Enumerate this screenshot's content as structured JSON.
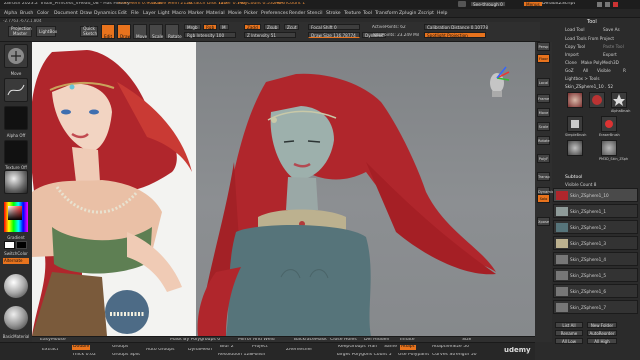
{
  "titlebar": {
    "app": "ZBrush 2023.2",
    "file": "Tribal_Princess_vHead_08 - Has History",
    "free_mem": "Free Mem 0.905GB",
    "active_mem": "Active Mem 2120",
    "scratch_disk": "Scratch Disk 125",
    "timer": "Timer 0.192",
    "polycount": "PolyCount 0.532 KP",
    "meshcount": "MeshCount 1",
    "see_through_label": "See-through 0",
    "menus_label": "Menus",
    "default_zscript": "DefaultZScript"
  },
  "menubar": {
    "items": [
      "Alpha",
      "Brush",
      "Color",
      "Document",
      "Draw",
      "Dynamics",
      "Edit",
      "File",
      "Layer",
      "Light",
      "Macro",
      "Marker",
      "Material",
      "Movie",
      "Picker",
      "Preferences",
      "Render",
      "Stencil",
      "Stroke",
      "Texture",
      "Tool",
      "Transform",
      "Zplugin",
      "Zscript",
      "Help"
    ]
  },
  "coords": "-2.7763,-672,1.804",
  "shelf": {
    "projection_master": "Projection Master",
    "lightbox": "LightBox",
    "quick_sketch": "Quick Sketch",
    "edit": "Edit",
    "draw": "Draw",
    "move": "Move",
    "scale": "Scale",
    "rotate": "Rotate",
    "mrgb": "Mrgb",
    "rgb": "Rgb",
    "m": "M",
    "zadd": "Zadd",
    "zsub": "Zsub",
    "zcut": "Zcut",
    "focal_shift": "Focal Shift 0",
    "rgb_intensity": "Rgb Intensity 100",
    "z_intensity": "Z Intensity 51",
    "draw_size": "Draw Size 116.78774",
    "dynamic": "Dynamic",
    "active_points": "ActivePoints: 62",
    "total_points": "TotalPoints: 23.249 Mil",
    "calibration": "Calibration Distance 0.10778",
    "spotlight_projection": "Spotlight Projection"
  },
  "leftshelf": {
    "labels": [
      "Move",
      "Alpha Off",
      "Texture Off",
      "Gradient",
      "SwitchColor",
      "Alternate",
      "BasicMaterial"
    ]
  },
  "bottom": {
    "row1": [
      "EasyMouse",
      "Mask By Polygroups 0",
      "Mirror And Weld",
      "BackfaceMask",
      "Close Holes",
      "Del Hidden",
      "Inflate",
      "Size"
    ],
    "row2": [
      "Extract",
      "Double",
      "Thick 0.02",
      "Groups",
      "Groups Split",
      "Auto Groups",
      "DynaMesh",
      "Blur 2",
      "Resolution 128",
      "Project",
      "Polish",
      "ZRemesher",
      "KeepGroups",
      "Half",
      "Same",
      "Adapt",
      "Target Polygons Count 5",
      "Use Polypaint",
      "AdaptiveSize 50",
      "Curves Strength 50"
    ],
    "watermark": "udemy"
  },
  "toolpanel": {
    "title": "Tool",
    "rows": [
      "Load Tool",
      "Save As",
      "Load Tools From Project",
      "Copy Tool",
      "Paste Tool",
      "Import",
      "Export",
      "Clone",
      "Make PolyMesh3D",
      "GoZ",
      "All",
      "Visible",
      "R",
      "Lightbox > Tools",
      "Skin_ZSphere1_10 . 52"
    ],
    "tool_thumbs": [
      "Skin_ZSphere1_10",
      "AlphaBrush",
      "SimpleBrush",
      "EraserBrush",
      "Skin_ZSphere1_1",
      "PM3D_Skin_ZSph"
    ],
    "subtool_title": "Subtool",
    "visible_count": "Visible Count 8",
    "subtools": [
      "Skin_ZSphere1_10",
      "Skin_ZSphere1_1",
      "Skin_ZSphere1_2",
      "Skin_ZSphere1_3",
      "Skin_ZSphere1_4",
      "Skin_ZSphere1_5",
      "Skin_ZSphere1_6",
      "Skin_ZSphere1_7"
    ],
    "list_all": "List All",
    "new_folder": "New Folder",
    "rename": "Rename",
    "autoreorder": "AutoReorder",
    "all_low": "All Low",
    "all_high": "All High"
  },
  "rightdock": [
    "Persp",
    "Floor",
    "Local",
    "Frame",
    "Move",
    "Scale",
    "Rotate",
    "PolyF",
    "Transp",
    "Dynamic",
    "Solo",
    "Xpose"
  ],
  "colors": {
    "accent": "#e8731d",
    "hair": "#b0262c",
    "skin_model": "#9aa8a6",
    "dress": "#56747a"
  }
}
